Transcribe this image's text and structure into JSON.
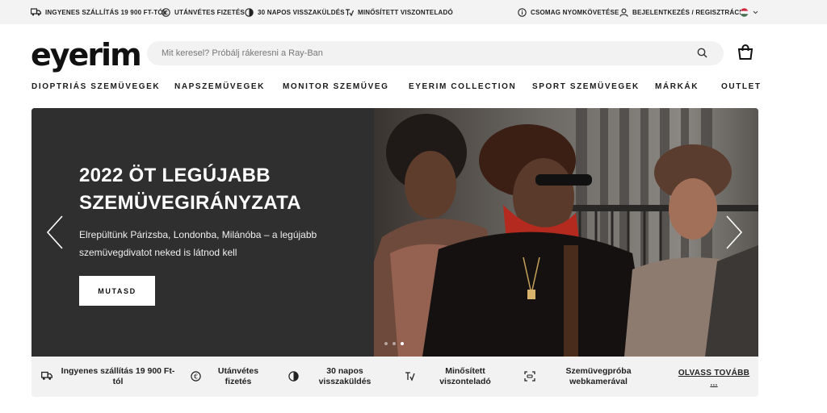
{
  "topbar": {
    "free_shipping": "INGYENES SZÁLLÍTÁS 19 900 FT-TÓL",
    "cod": "UTÁNVÉTES FIZETÉS",
    "returns": "30 NAPOS VISSZAKÜLDÉS",
    "certified": "MINŐSÍTETT VISZONTELADÓ",
    "tracking": "CSOMAG NYOMKÖVETÉSE",
    "login": "BEJELENTKEZÉS / REGISZTRÁCIÓ",
    "language_flag": "hungary-flag"
  },
  "header": {
    "logo": "eyerim",
    "search_placeholder": "Mit keresel? Próbálj rákeresni a Ray-Ban"
  },
  "nav": [
    "DIOPTRIÁS SZEMÜVEGEK",
    "NAPSZEMÜVEGEK",
    "MONITOR SZEMÜVEG",
    "EYERIM COLLECTION",
    "SPORT SZEMÜVEGEK",
    "MÁRKÁK",
    "OUTLET"
  ],
  "hero": {
    "title": "2022 ÖT LEGÚJABB SZEMÜVEGIRÁNYZATA",
    "subtitle": "Elrepültünk Párizsba, Londonba, Milánóba – a legújabb szemüvegdivatot neked is látnod kell",
    "button": "MUTASD",
    "slides_total": 3,
    "slide_active": 3
  },
  "benefits": {
    "items": [
      {
        "icon": "truck-icon",
        "text": "Ingyenes szállítás 19 900 Ft-tól"
      },
      {
        "icon": "euro-icon",
        "text": "Utánvétes fizetés"
      },
      {
        "icon": "return-icon",
        "text": "30 napos visszaküldés"
      },
      {
        "icon": "certified-icon",
        "text": "Minősített viszonteladó"
      },
      {
        "icon": "webcam-tryon-icon",
        "text": "Szemüvegpróba webkamerával"
      }
    ],
    "read_more": "OLVASS TOVÁBB ..."
  },
  "colors": {
    "hero_dark": "#2f2f2f",
    "topbar_bg": "#f3f3f3",
    "search_bg": "#f2f2f2"
  }
}
